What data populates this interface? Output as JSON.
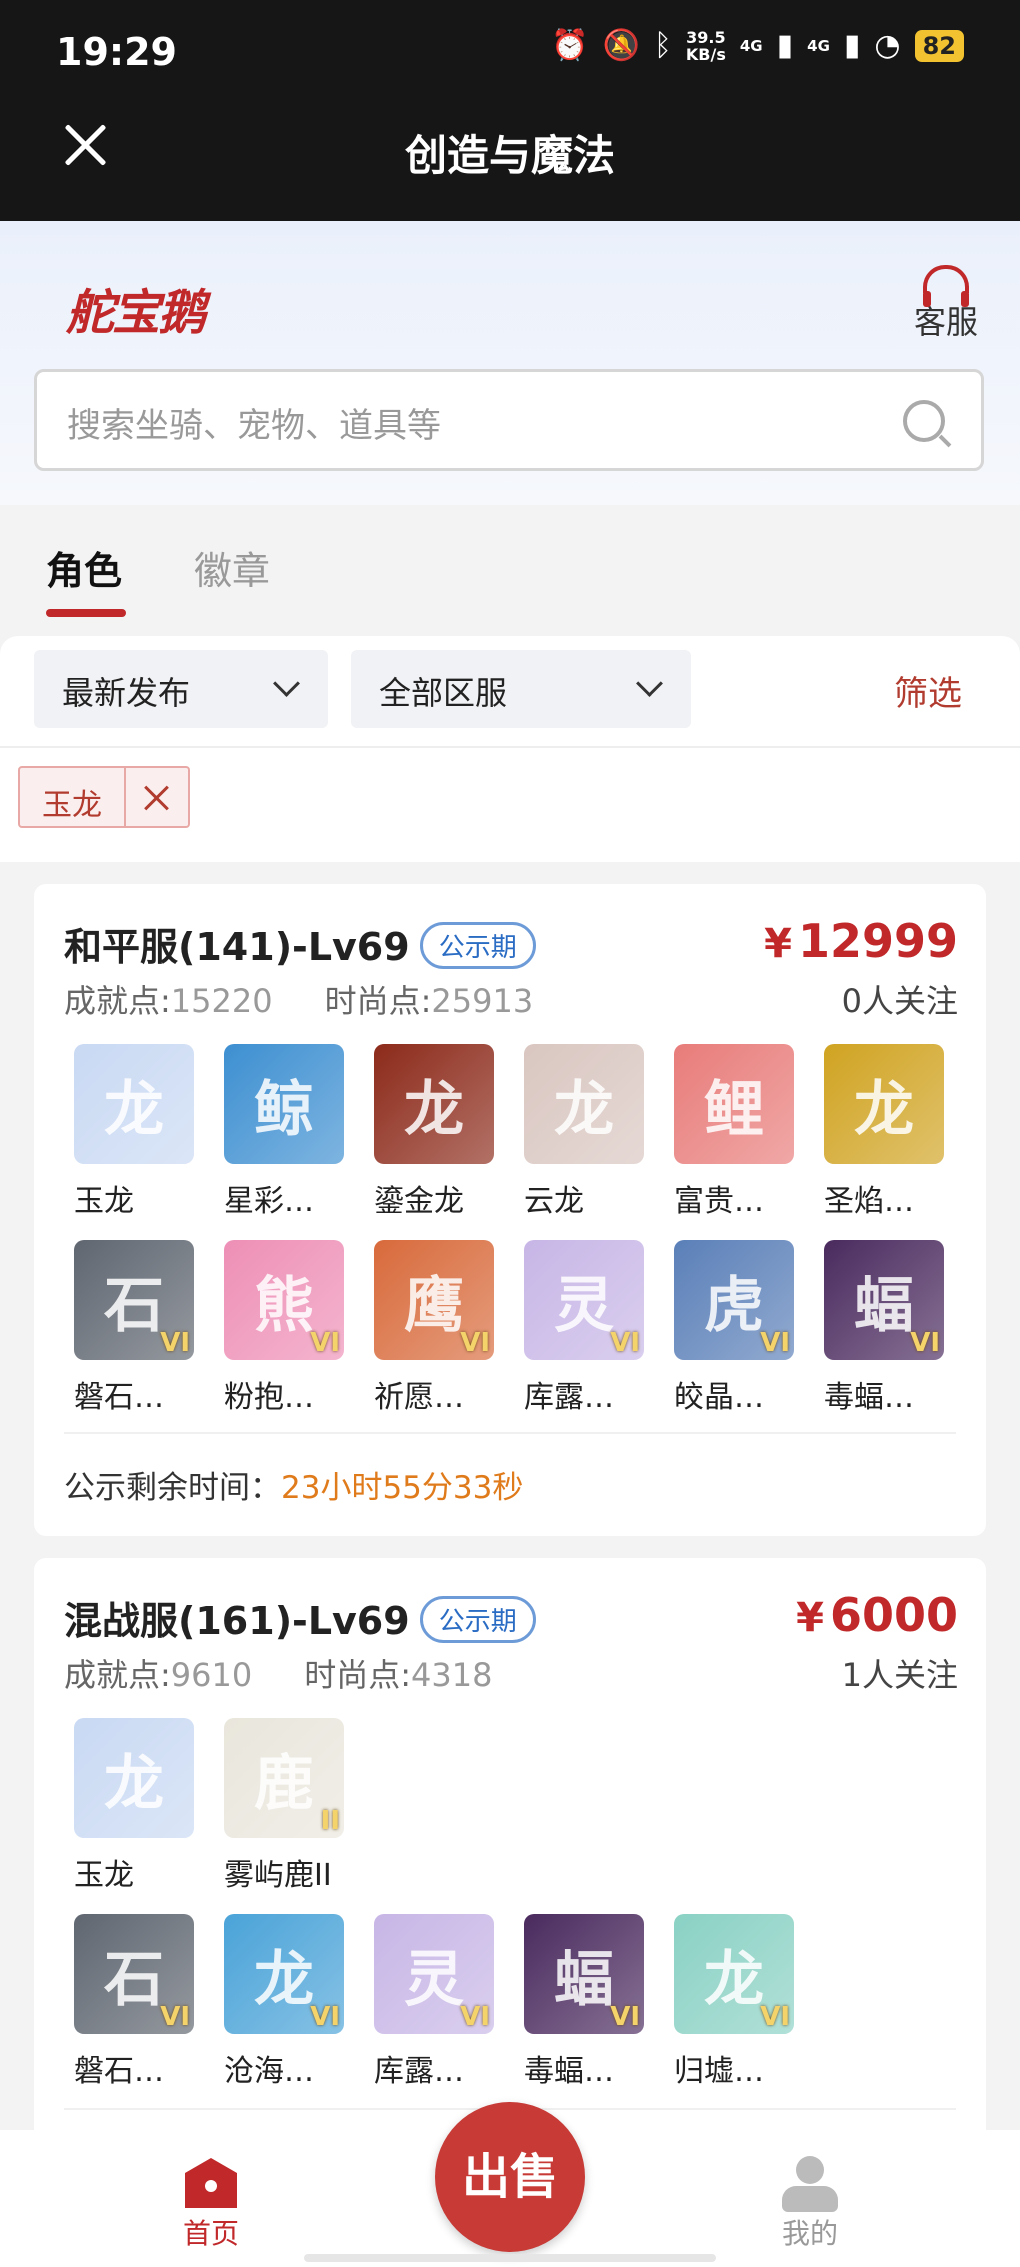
{
  "status": {
    "time": "19:29",
    "net_speed": "39.5",
    "net_unit": "KB/s",
    "sig1": "4G",
    "sig2": "4G",
    "battery": "82"
  },
  "app": {
    "title": "创造与魔法"
  },
  "header": {
    "logo": "舵宝鹅",
    "service_label": "客服",
    "search_placeholder": "搜索坐骑、宠物、道具等"
  },
  "tabs": [
    {
      "label": "角色",
      "active": true
    },
    {
      "label": "徽章",
      "active": false
    }
  ],
  "filters": {
    "sort_label": "最新发布",
    "server_label": "全部区服",
    "filter_link": "筛选",
    "tag": "玉龙"
  },
  "listings": [
    {
      "title": "和平服(141)-Lv69",
      "badge": "公示期",
      "achievement_label": "成就点:",
      "achievement": "15220",
      "fashion_label": "时尚点:",
      "fashion": "25913",
      "currency": "¥",
      "price": "12999",
      "watchers": "0人关注",
      "items_row1": [
        {
          "name": "玉龙",
          "color": "#c9d9f3",
          "glyph": "龙"
        },
        {
          "name": "星彩…",
          "color": "#3d8fd1",
          "glyph": "鲸"
        },
        {
          "name": "鎏金龙",
          "color": "#8c2a1a",
          "glyph": "龙"
        },
        {
          "name": "云龙",
          "color": "#d9c6c0",
          "glyph": "龙"
        },
        {
          "name": "富贵…",
          "color": "#e87c7a",
          "glyph": "鲤"
        },
        {
          "name": "圣焰…",
          "color": "#d0a321",
          "glyph": "龙"
        }
      ],
      "items_row2": [
        {
          "name": "磐石…",
          "color": "#5f6670",
          "glyph": "石",
          "level": "VI"
        },
        {
          "name": "粉抱…",
          "color": "#ee8fb6",
          "glyph": "熊",
          "level": "VI"
        },
        {
          "name": "祈愿…",
          "color": "#d86a3b",
          "glyph": "鹰",
          "level": "VI"
        },
        {
          "name": "库露…",
          "color": "#c7b6e6",
          "glyph": "灵",
          "level": "VI"
        },
        {
          "name": "皎晶…",
          "color": "#5a7fb8",
          "glyph": "虎",
          "level": "VI"
        },
        {
          "name": "毒蝠…",
          "color": "#4a2a5e",
          "glyph": "蝠",
          "level": "VI"
        }
      ],
      "countdown_label": "公示剩余时间：",
      "countdown_value": "23小时55分33秒"
    },
    {
      "title": "混战服(161)-Lv69",
      "badge": "公示期",
      "achievement_label": "成就点:",
      "achievement": "9610",
      "fashion_label": "时尚点:",
      "fashion": "4318",
      "currency": "¥",
      "price": "6000",
      "watchers": "1人关注",
      "items_row1": [
        {
          "name": "玉龙",
          "color": "#c9d9f3",
          "glyph": "龙"
        },
        {
          "name": "雾屿鹿II",
          "color": "#e9e6dc",
          "glyph": "鹿",
          "level": "II"
        }
      ],
      "items_row2": [
        {
          "name": "磐石…",
          "color": "#5f6670",
          "glyph": "石",
          "level": "VI"
        },
        {
          "name": "沧海…",
          "color": "#4aa3d8",
          "glyph": "龙",
          "level": "VI"
        },
        {
          "name": "库露…",
          "color": "#c7b6e6",
          "glyph": "灵",
          "level": "VI"
        },
        {
          "name": "毒蝠…",
          "color": "#4a2a5e",
          "glyph": "蝠",
          "level": "VI"
        },
        {
          "name": "归墟…",
          "color": "#8ad1c4",
          "glyph": "龙",
          "level": "VI"
        }
      ]
    }
  ],
  "bottom_nav": {
    "home_label": "首页",
    "sell_label": "出售",
    "me_label": "我的"
  },
  "colors": {
    "brand_red": "#c0282a",
    "countdown_orange": "#e07b1c",
    "badge_blue": "#2a6cc4"
  }
}
